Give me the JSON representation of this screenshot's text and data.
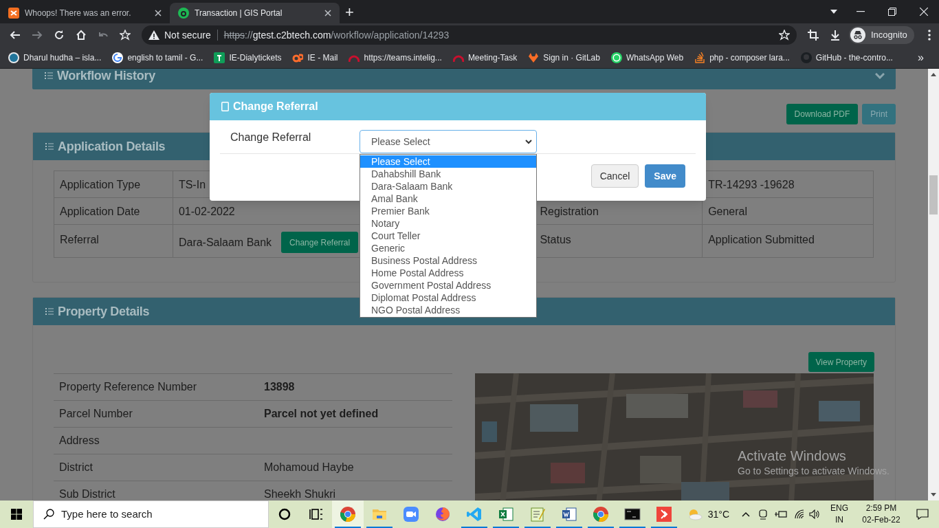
{
  "browser": {
    "tabs": [
      {
        "title": "Whoops! There was an error.",
        "selected": false
      },
      {
        "title": "Transaction | GIS Portal",
        "selected": true
      }
    ],
    "new_tab": "+",
    "address": {
      "security": "Not secure",
      "scheme": "https",
      "separator": "://",
      "host": "gtest.c2btech.com",
      "path": "/workflow/application/14293"
    },
    "profile": "Incognito",
    "bookmarks": [
      {
        "label": "Dharul hudha – isla..."
      },
      {
        "label": "english to tamil - G..."
      },
      {
        "label": "IE-Dialytickets"
      },
      {
        "label": "IE - Mail"
      },
      {
        "label": "https://teams.intelig..."
      },
      {
        "label": "Meeting-Task"
      },
      {
        "label": "Sign in · GitLab"
      },
      {
        "label": "WhatsApp Web"
      },
      {
        "label": "php - composer lara..."
      },
      {
        "label": "GitHub - the-contro..."
      }
    ],
    "bookmarks_overflow": "»"
  },
  "page": {
    "workflow_history": {
      "title": "Workflow History"
    },
    "actions": [
      "Download PDF",
      "Print"
    ],
    "application_details": {
      "title": "Application Details",
      "rows": [
        {
          "label": "Application Type",
          "value": "TS-In",
          "label_2": "",
          "value_2": "TR-14293 -19628"
        },
        {
          "label": "Application Date",
          "value": "01-02-2022",
          "label_2": "Registration",
          "value_2": "General"
        },
        {
          "label": "Referral",
          "value": "Dara-Salaam Bank",
          "button": "Change Referral",
          "label_2": "Status",
          "value_2": "Application Submitted"
        }
      ]
    },
    "property_details": {
      "title": "Property Details",
      "button": "View Property",
      "rows": [
        {
          "label": "Property Reference Number",
          "value": "13898",
          "bold": true
        },
        {
          "label": "Parcel Number",
          "value": "Parcel not yet defined",
          "bold": true
        },
        {
          "label": "Address",
          "value": ""
        },
        {
          "label": "District",
          "value": "Mohamoud Haybe",
          "bold": false
        },
        {
          "label": "Sub District",
          "value": "Sheekh Shukri",
          "bold": false
        }
      ]
    }
  },
  "modal": {
    "title": "Change Referral",
    "field_label": "Change Referral",
    "select_value": "Please Select",
    "options": [
      {
        "label": "Please Select",
        "selected": true
      },
      {
        "label": "Dahabshill Bank",
        "selected": false
      },
      {
        "label": "Dara-Salaam Bank",
        "selected": false
      },
      {
        "label": "Amal Bank",
        "selected": false
      },
      {
        "label": "Premier Bank",
        "selected": false
      },
      {
        "label": "Notary",
        "selected": false
      },
      {
        "label": "Court Teller",
        "selected": false
      },
      {
        "label": "Generic",
        "selected": false
      },
      {
        "label": "Business Postal Address",
        "selected": false
      },
      {
        "label": "Home Postal Address",
        "selected": false
      },
      {
        "label": "Government Postal Address",
        "selected": false
      },
      {
        "label": "Diplomat Postal Address",
        "selected": false
      },
      {
        "label": "NGO Postal Address",
        "selected": false
      }
    ],
    "buttons": [
      "Cancel",
      "Save"
    ]
  },
  "os_notice": {
    "title": "Activate Windows",
    "text": "Go to Settings to activate Windows."
  },
  "taskbar": {
    "search_placeholder": "Type here to search",
    "apps": [
      {
        "running": false,
        "selected": false
      },
      {
        "running": false,
        "selected": false
      },
      {
        "running": true,
        "selected": true
      },
      {
        "running": true,
        "selected": false
      },
      {
        "running": false,
        "selected": false
      },
      {
        "running": false,
        "selected": false
      },
      {
        "running": true,
        "selected": false
      },
      {
        "running": true,
        "selected": false
      },
      {
        "running": true,
        "selected": false
      },
      {
        "running": true,
        "selected": false
      },
      {
        "running": true,
        "selected": false
      },
      {
        "running": true,
        "selected": false
      },
      {
        "running": true,
        "selected": false
      }
    ],
    "temperature": "31°C",
    "language": "ENG",
    "region": "IN",
    "time": "2:59 PM",
    "date": "02-Feb-22"
  }
}
